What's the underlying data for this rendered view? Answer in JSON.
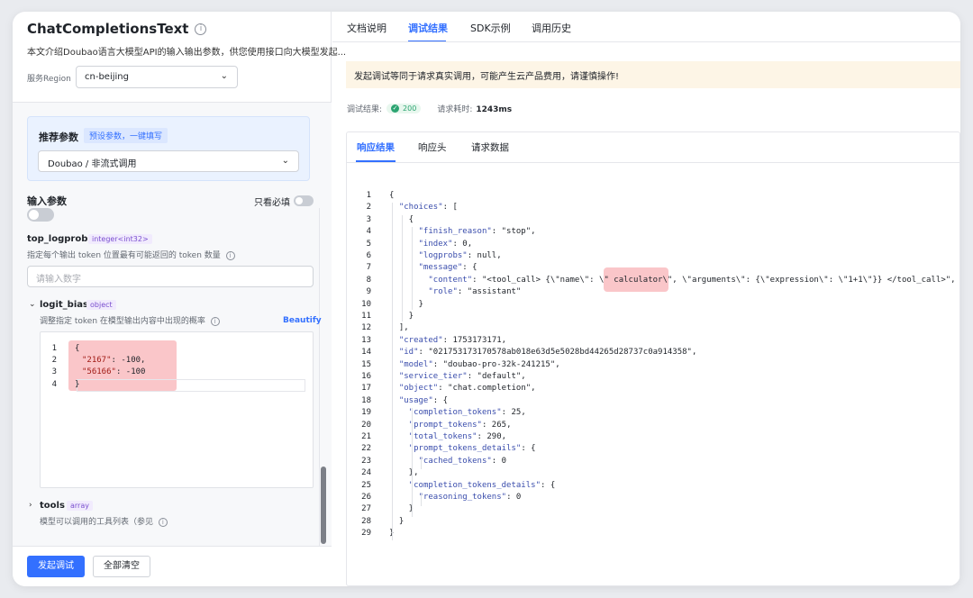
{
  "left": {
    "title": "ChatCompletionsText",
    "description": "本文介绍Doubao语言大模型API的输入输出参数，供您使用接口向大模型发起...",
    "region_label": "服务Region",
    "region_value": "cn-beijing",
    "recommended": {
      "title": "推荐参数",
      "tag": "预设参数，一键填写",
      "select_value": "Doubao / 非流式调用"
    },
    "input_params_title": "输入参数",
    "only_required_label": "只看必填",
    "top_logprobs": {
      "name": "top_logprobs",
      "type": "integer<int32>",
      "desc": "指定每个输出 token 位置最有可能返回的 token 数量",
      "placeholder": "请输入数字"
    },
    "logit_bias": {
      "name": "logit_bias",
      "type": "object",
      "desc": "调整指定 token 在模型输出内容中出现的概率",
      "beautify": "Beautify",
      "code": [
        {
          "n": "1",
          "text": "{"
        },
        {
          "n": "2",
          "key": "\"2167\"",
          "val": ": -100,"
        },
        {
          "n": "3",
          "key": "\"56166\"",
          "val": ": -100"
        },
        {
          "n": "4",
          "text": "}"
        }
      ]
    },
    "tools": {
      "name": "tools",
      "type": "array",
      "desc": "模型可以调用的工具列表（参见"
    },
    "submit_button": "发起调试",
    "clear_button": "全部清空"
  },
  "right": {
    "tabs": [
      "文档说明",
      "调试结果",
      "SDK示例",
      "调用历史"
    ],
    "active_tab": "调试结果",
    "warning": "发起调试等同于请求真实调用，可能产生云产品费用，请谨慎操作!",
    "status_label": "调试结果:",
    "status_code": "200",
    "time_label": "请求耗时:",
    "time_value": "1243ms",
    "response_tabs": [
      "响应结果",
      "响应头",
      "请求数据"
    ],
    "response_lines": [
      "{",
      "  \"choices\": [",
      "    {",
      "      \"finish_reason\": \"stop\",",
      "      \"index\": 0,",
      "      \"logprobs\": null,",
      "      \"message\": {",
      "        \"content\": \"<tool_call> {\\\"name\\\": \\\" calculator\\\", \\\"arguments\\\": {\\\"expression\\\": \\\"1+1\\\"}} </tool_call>\",",
      "        \"role\": \"assistant\"",
      "      }",
      "    }",
      "  ],",
      "  \"created\": 1753173171,",
      "  \"id\": \"021753173170578ab018e63d5e5028bd44265d28737c0a914358\",",
      "  \"model\": \"doubao-pro-32k-241215\",",
      "  \"service_tier\": \"default\",",
      "  \"object\": \"chat.completion\",",
      "  \"usage\": {",
      "    \"completion_tokens\": 25,",
      "    \"prompt_tokens\": 265,",
      "    \"total_tokens\": 290,",
      "    \"prompt_tokens_details\": {",
      "      \"cached_tokens\": 0",
      "    },",
      "    \"completion_tokens_details\": {",
      "      \"reasoning_tokens\": 0",
      "    }",
      "  }",
      "}"
    ]
  },
  "colors": {
    "accent": "#3370ff",
    "success": "#2ba471",
    "highlight": "#f9bcc0",
    "warning_bg": "#fdf5e6"
  }
}
